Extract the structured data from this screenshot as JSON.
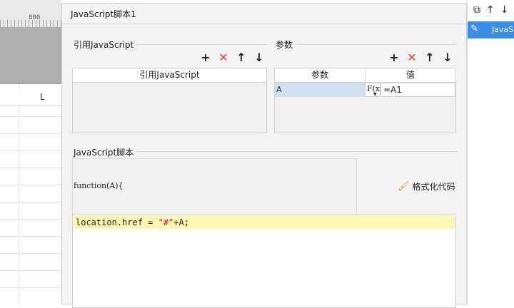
{
  "sheet": {
    "ruler_number": "800",
    "column_letter": "L"
  },
  "right_panel": {
    "toolbar_icons": [
      "copy-icon",
      "arrow-up-icon",
      "arrow-down-icon"
    ],
    "selected_item_label": "JavaS"
  },
  "dialog": {
    "title": "JavaScript脚本1",
    "import_section": {
      "label": "引用JavaScript",
      "column_header": "引用JavaScript"
    },
    "params_section": {
      "label": "参数",
      "columns": [
        "参数",
        "值"
      ],
      "rows": [
        {
          "name": "A",
          "fx": "F(x)",
          "value": "=A1"
        }
      ]
    },
    "toolbar": {
      "add": "+",
      "remove": "✕",
      "up": "↑",
      "down": "↓"
    },
    "script_section": {
      "label": "JavaScript脚本",
      "function_signature": "function(A){",
      "format_button": "格式化代码",
      "code": {
        "prefix": "location.href = ",
        "string": "\"#\"",
        "suffix": "+A;"
      }
    }
  }
}
